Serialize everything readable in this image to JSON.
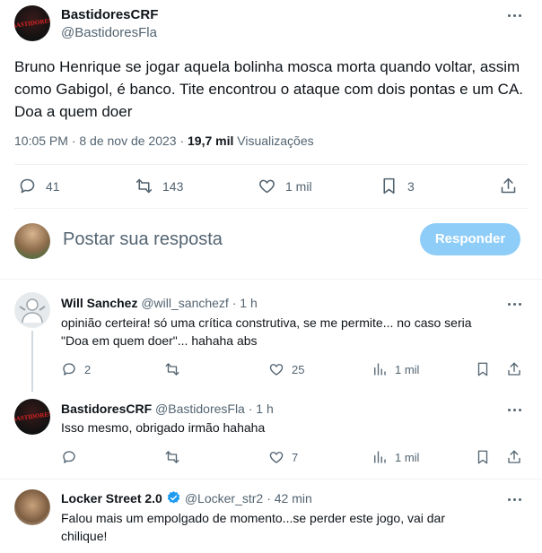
{
  "main_tweet": {
    "display_name": "BastidoresCRF",
    "handle": "@BastidoresFla",
    "avatar_text": "BASTIDORES",
    "text": "Bruno Henrique se jogar aquela bolinha mosca morta quando voltar, assim como Gabigol, é banco. Tite encontrou o ataque com dois pontas e um CA. Doa a quem doer",
    "time": "10:05 PM · 8 de nov de 2023 ·",
    "views_count": "19,7 mil",
    "views_label": "Visualizações",
    "stats": {
      "replies": "41",
      "retweets": "143",
      "likes": "1 mil",
      "bookmarks": "3"
    }
  },
  "reply_box": {
    "placeholder": "Postar sua resposta",
    "button_label": "Responder",
    "button_color": "#8ecdf8"
  },
  "replies": [
    {
      "display_name": "Will Sanchez",
      "handle": "@will_sanchezf",
      "time": "· 1 h",
      "text_line1": "opinião certeira! só uma crítica construtiva, se me permite... no caso seria",
      "text_line2": "\"Doa em quem doer\"... hahaha abs",
      "stats": {
        "replies": "2",
        "retweets": "",
        "likes": "25",
        "views": "1 mil"
      }
    },
    {
      "display_name": "BastidoresCRF",
      "handle": "@BastidoresFla",
      "time": "· 1 h",
      "avatar_text": "BASTIDORES",
      "text_line1": "Isso mesmo, obrigado irmão hahaha",
      "stats": {
        "replies": "",
        "retweets": "",
        "likes": "7",
        "views": "1 mil"
      }
    },
    {
      "display_name": "Locker Street 2.0",
      "handle": "@Locker_str2",
      "time": "· 42 min",
      "verified_color": "#1d9bf0",
      "text_line1": "Falou mais um empolgado de momento...se perder este jogo, vai dar",
      "text_line2": "chilique!"
    }
  ]
}
